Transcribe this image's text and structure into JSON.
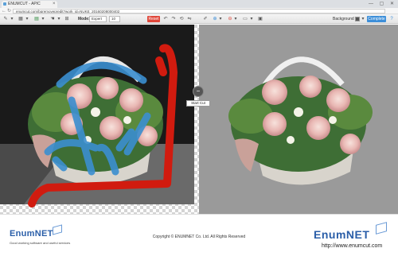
{
  "browser": {
    "tab_title": "ENUMCUT - APIC",
    "url": "enumcut.com/bgremovepredit?work_id=NUKE_20160208000402",
    "win_controls": "— ▢ ✕"
  },
  "toolbar": {
    "mode_label": "Mode:",
    "mode_value": "Expert",
    "size_value": "10",
    "reset_label": "Reset",
    "background_label": "Background",
    "complete_label": "Complete",
    "accent_red": "#e0473a",
    "accent_blue": "#3d8fd9"
  },
  "editor": {
    "start_cut_label": "Start Cut",
    "stroke_foreground": "#3b8fd0",
    "stroke_background": "#d11b0f"
  },
  "footer": {
    "logo_left": "EnumNET",
    "logo_left_tagline": "Good working software and useful services",
    "copyright": "Copyright © ENUMNET Co. Ltd. All Rights Reserved",
    "logo_right": "EnumNET",
    "logo_right_url": "http://www.enumcut.com"
  }
}
